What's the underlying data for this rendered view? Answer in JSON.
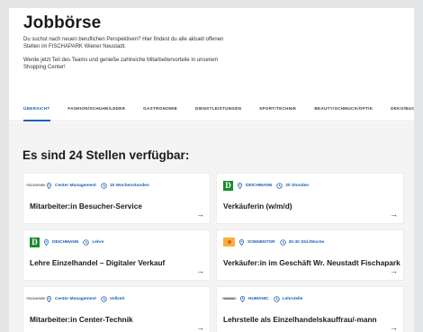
{
  "page": {
    "title": "Jobbörse",
    "intro": "Du suchst nach neuen beruflichen Perspektiven? Hier findest du alle aktuell offenen Stellen im FISCHAPARK Wiener Neustadt.",
    "intro2": "Werde jetzt Teil des Teams und genieße zahlreiche Mitarbeitervorteile in unserem Shopping Center!"
  },
  "tabs": [
    {
      "label": "ÜBERSICHT",
      "active": true
    },
    {
      "label": "FASHION/SCHUHE/LEDER"
    },
    {
      "label": "GASTRONOMIE"
    },
    {
      "label": "DIENSTLEISTUNGEN"
    },
    {
      "label": "SPORT/TECHNIK"
    },
    {
      "label": "BEAUTY/SCHMUCK/OPTIK"
    },
    {
      "label": "DEKO/BUCH"
    }
  ],
  "listing": {
    "count_title": "Es sind 24 Stellen verfügbar:"
  },
  "jobs": [
    {
      "logo": "fischapark-logo",
      "logo_text": "FISCHAPARK",
      "company": "Center Management",
      "hours": "15 Wochenstunden",
      "title": "Mitarbeiter:in Besucher-Service",
      "arrow": "→"
    },
    {
      "logo": "deichmann-logo",
      "logo_text": "D",
      "company": "DEICHMANN",
      "hours": "20 Stunden",
      "title": "Verkäuferin (w/m/d)",
      "arrow": "→"
    },
    {
      "logo": "deichmann-logo",
      "logo_text": "D",
      "company": "DEICHMANN",
      "hours": "Lehre",
      "title": "Lehre Einzelhandel – Digitaler Verkauf",
      "arrow": "→"
    },
    {
      "logo": "sonnentor-logo",
      "logo_text": "",
      "company": "SONNENTOR",
      "hours": "30-30 Std./Woche",
      "title": "Verkäufer:in im Geschäft Wr. Neustadt Fischapark",
      "arrow": "→"
    },
    {
      "logo": "fischapark-logo",
      "logo_text": "FISCHAPARK",
      "company": "Center Management",
      "hours": "Vollzeit",
      "title": "Mitarbeiter:in Center-Technik",
      "arrow": "→"
    },
    {
      "logo": "humanic-logo",
      "logo_text": "HUMANIC",
      "company": "HUMANIC",
      "hours": "Lehrstelle",
      "title": "Lehrstelle als Einzelhandelskauffrau/-mann",
      "arrow": "→"
    }
  ],
  "colors": {
    "accent": "#1b5fb6",
    "background": "#e3e5e7",
    "list_background": "#f4f4f4",
    "deichmann_green": "#1b8a2b",
    "sonnentor_yellow": "#f6b13a"
  },
  "icons": {
    "location": "map-pin-icon",
    "time": "clock-icon",
    "arrow": "arrow-right-icon"
  }
}
